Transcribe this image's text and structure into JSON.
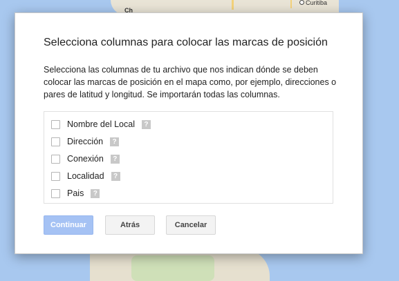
{
  "map": {
    "city_top_left": "Ch",
    "city_top_right": "Curitiba"
  },
  "dialog": {
    "title": "Selecciona columnas para colocar las marcas de posición",
    "description": "Selecciona las columnas de tu archivo que nos indican dónde se deben colocar las marcas de posición en el mapa como, por ejemplo, direcciones o pares de latitud y longitud. Se importarán todas las columnas.",
    "options": [
      {
        "label": "Nombre del Local",
        "checked": false,
        "help_icon": "?"
      },
      {
        "label": "Dirección",
        "checked": false,
        "help_icon": "?"
      },
      {
        "label": "Conexión",
        "checked": false,
        "help_icon": "?"
      },
      {
        "label": "Localidad",
        "checked": false,
        "help_icon": "?"
      },
      {
        "label": "Pais",
        "checked": false,
        "help_icon": "?"
      }
    ],
    "buttons": {
      "continue": "Continuar",
      "back": "Atrás",
      "cancel": "Cancelar"
    }
  },
  "colors": {
    "primary_button_disabled": "#a5c2f4",
    "map_water": "#a8c8ef",
    "map_land": "#e9e4d6"
  }
}
